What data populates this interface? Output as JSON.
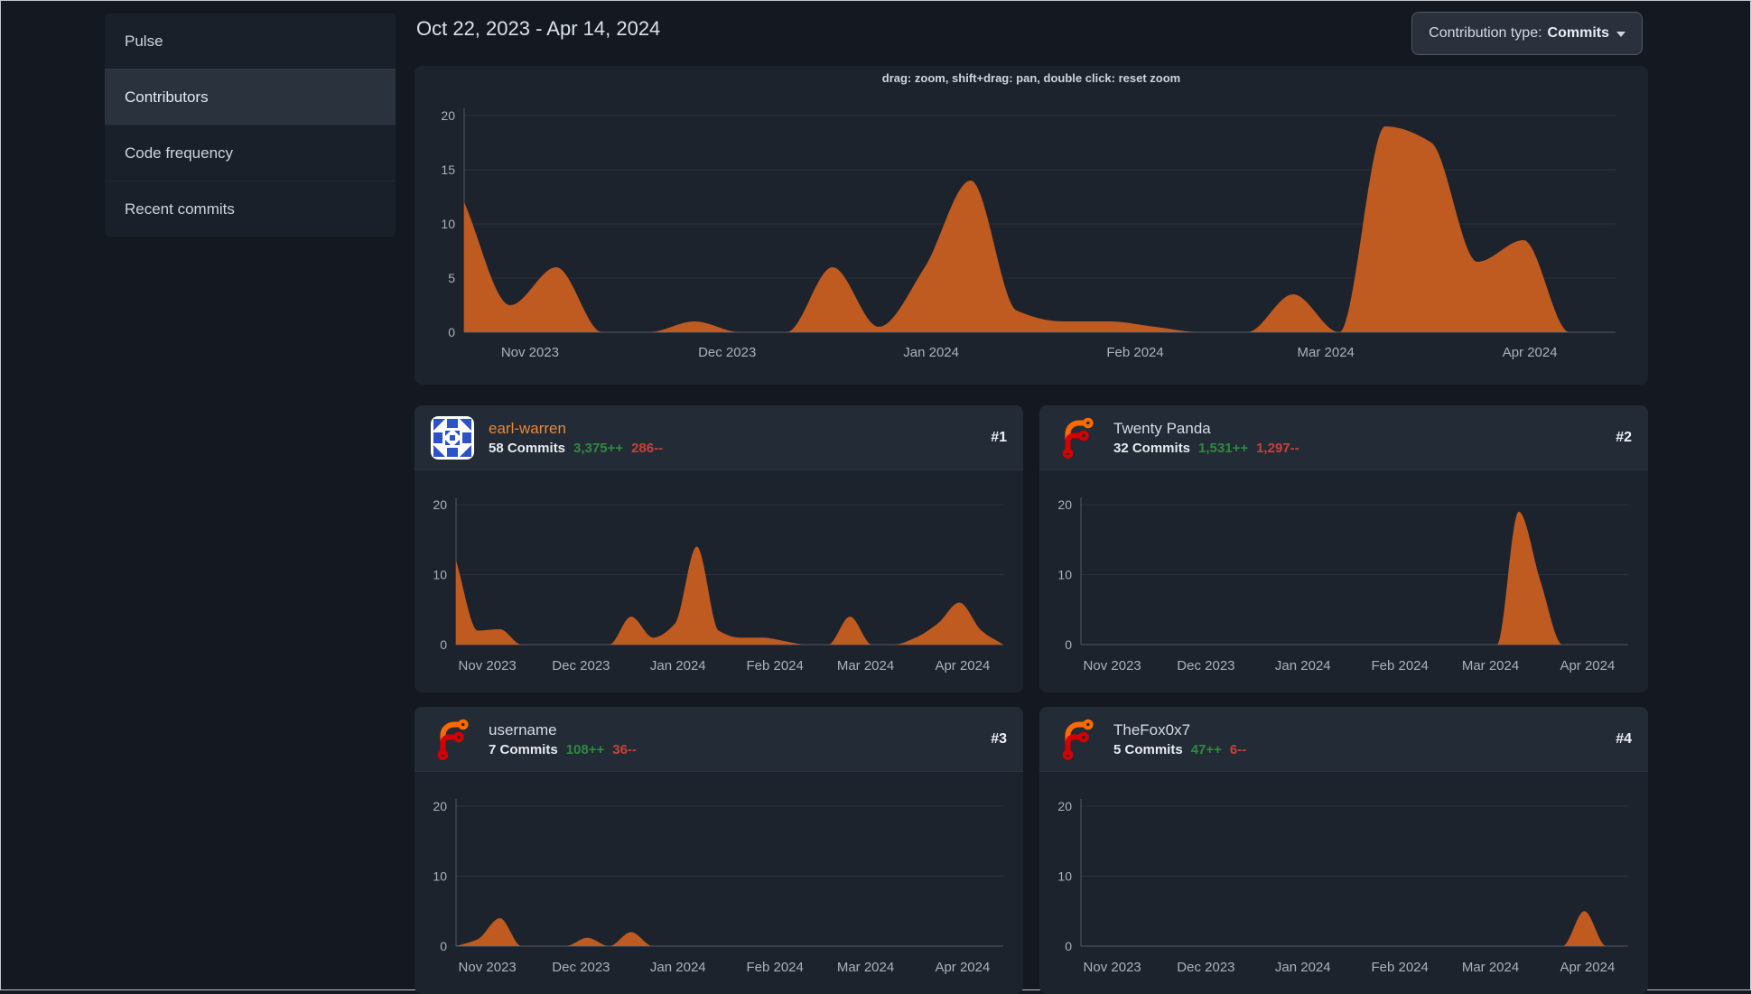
{
  "sidebar": {
    "items": [
      {
        "label": "Pulse",
        "active": false
      },
      {
        "label": "Contributors",
        "active": true
      },
      {
        "label": "Code frequency",
        "active": false
      },
      {
        "label": "Recent commits",
        "active": false
      }
    ]
  },
  "header": {
    "date_range": "Oct 22, 2023 - Apr 14, 2024",
    "contribution_type_label": "Contribution type:",
    "contribution_type_value": "Commits"
  },
  "overview": {
    "hint": "drag: zoom, shift+drag: pan, double click: reset zoom"
  },
  "contributors": [
    {
      "rank": "#1",
      "name": "earl-warren",
      "name_color": "#e8873b",
      "avatar": "identicon",
      "commits": "58 Commits",
      "additions": "3,375++",
      "deletions": "286--"
    },
    {
      "rank": "#2",
      "name": "Twenty Panda",
      "name_color": "#d5dce3",
      "avatar": "forgejo",
      "commits": "32 Commits",
      "additions": "1,531++",
      "deletions": "1,297--"
    },
    {
      "rank": "#3",
      "name": "username",
      "name_color": "#d5dce3",
      "avatar": "forgejo",
      "commits": "7 Commits",
      "additions": "108++",
      "deletions": "36--"
    },
    {
      "rank": "#4",
      "name": "TheFox0x7",
      "name_color": "#d5dce3",
      "avatar": "forgejo",
      "commits": "5 Commits",
      "additions": "47++",
      "deletions": "6--"
    }
  ],
  "chart_data": [
    {
      "id": "overview-commits-per-week",
      "type": "area",
      "title": "",
      "x_unit": "weeks since Oct 22, 2023",
      "x_domain": [
        0,
        25
      ],
      "ylim": [
        0,
        20
      ],
      "yticks": [
        0,
        5,
        10,
        15,
        20
      ],
      "xlabels": [
        {
          "pos": 1.43,
          "label": "Nov 2023"
        },
        {
          "pos": 5.71,
          "label": "Dec 2023"
        },
        {
          "pos": 10.14,
          "label": "Jan 2024"
        },
        {
          "pos": 14.57,
          "label": "Feb 2024"
        },
        {
          "pos": 18.71,
          "label": "Mar 2024"
        },
        {
          "pos": 23.14,
          "label": "Apr 2024"
        }
      ],
      "values": [
        12,
        2.5,
        6,
        0,
        0,
        1,
        0,
        0,
        6,
        0.5,
        6,
        14,
        2,
        1,
        1,
        0.5,
        0,
        0,
        3.5,
        0,
        19,
        17.5,
        6.5,
        8.5,
        0,
        0
      ],
      "area_color": "#bf5a21",
      "grid": true,
      "legend": "none"
    },
    {
      "id": "earl-warren-commits-per-week",
      "type": "area",
      "x_domain": [
        0,
        25
      ],
      "ylim": [
        0,
        20
      ],
      "yticks": [
        0,
        10,
        20
      ],
      "xlabels": [
        {
          "pos": 1.43,
          "label": "Nov 2023"
        },
        {
          "pos": 5.71,
          "label": "Dec 2023"
        },
        {
          "pos": 10.14,
          "label": "Jan 2024"
        },
        {
          "pos": 14.57,
          "label": "Feb 2024"
        },
        {
          "pos": 18.71,
          "label": "Mar 2024"
        },
        {
          "pos": 23.14,
          "label": "Apr 2024"
        }
      ],
      "values": [
        12,
        2,
        2.2,
        0,
        0,
        0,
        0,
        0,
        4,
        1,
        3,
        14,
        2,
        1,
        1,
        0.5,
        0,
        0,
        4,
        0,
        0,
        1,
        3,
        6,
        2,
        0
      ],
      "area_color": "#bf5a21",
      "grid": true,
      "legend": "none"
    },
    {
      "id": "twenty-panda-commits-per-week",
      "type": "area",
      "x_domain": [
        0,
        25
      ],
      "ylim": [
        0,
        20
      ],
      "yticks": [
        0,
        10,
        20
      ],
      "xlabels": [
        {
          "pos": 1.43,
          "label": "Nov 2023"
        },
        {
          "pos": 5.71,
          "label": "Dec 2023"
        },
        {
          "pos": 10.14,
          "label": "Jan 2024"
        },
        {
          "pos": 14.57,
          "label": "Feb 2024"
        },
        {
          "pos": 18.71,
          "label": "Mar 2024"
        },
        {
          "pos": 23.14,
          "label": "Apr 2024"
        }
      ],
      "values": [
        0,
        0,
        0,
        0,
        0,
        0,
        0,
        0,
        0,
        0,
        0,
        0,
        0,
        0,
        0,
        0,
        0,
        0,
        0,
        0,
        19,
        9,
        0,
        0,
        0,
        0
      ],
      "area_color": "#bf5a21",
      "grid": true,
      "legend": "none"
    },
    {
      "id": "username-commits-per-week",
      "type": "area",
      "x_domain": [
        0,
        25
      ],
      "ylim": [
        0,
        20
      ],
      "yticks": [
        0,
        10,
        20
      ],
      "xlabels": [
        {
          "pos": 1.43,
          "label": "Nov 2023"
        },
        {
          "pos": 5.71,
          "label": "Dec 2023"
        },
        {
          "pos": 10.14,
          "label": "Jan 2024"
        },
        {
          "pos": 14.57,
          "label": "Feb 2024"
        },
        {
          "pos": 18.71,
          "label": "Mar 2024"
        },
        {
          "pos": 23.14,
          "label": "Apr 2024"
        }
      ],
      "values": [
        0,
        1,
        4,
        0,
        0,
        0,
        1.2,
        0,
        2,
        0,
        0,
        0,
        0,
        0,
        0,
        0,
        0,
        0,
        0,
        0,
        0,
        0,
        0,
        0,
        0,
        0
      ],
      "area_color": "#bf5a21",
      "grid": true,
      "legend": "none"
    },
    {
      "id": "thefox0x7-commits-per-week",
      "type": "area",
      "x_domain": [
        0,
        25
      ],
      "ylim": [
        0,
        20
      ],
      "yticks": [
        0,
        10,
        20
      ],
      "xlabels": [
        {
          "pos": 1.43,
          "label": "Nov 2023"
        },
        {
          "pos": 5.71,
          "label": "Dec 2023"
        },
        {
          "pos": 10.14,
          "label": "Jan 2024"
        },
        {
          "pos": 14.57,
          "label": "Feb 2024"
        },
        {
          "pos": 18.71,
          "label": "Mar 2024"
        },
        {
          "pos": 23.14,
          "label": "Apr 2024"
        }
      ],
      "values": [
        0,
        0,
        0,
        0,
        0,
        0,
        0,
        0,
        0,
        0,
        0,
        0,
        0,
        0,
        0,
        0,
        0,
        0,
        0,
        0,
        0,
        0,
        0,
        5,
        0,
        0
      ],
      "area_color": "#bf5a21",
      "grid": true,
      "legend": "none"
    }
  ],
  "colors": {
    "page_bg": "#141821",
    "panel_bg": "#1c232d",
    "card_header_bg": "#232b36",
    "sidebar_bg": "#1a2029",
    "sidebar_active_bg": "#2a323e",
    "area_orange": "#bf5a21",
    "link_orange": "#e8873b",
    "additions_green": "#2e8b40",
    "deletions_red": "#c5433a",
    "primary_text": "#d7dee6",
    "muted_text": "#a9b2bc"
  }
}
